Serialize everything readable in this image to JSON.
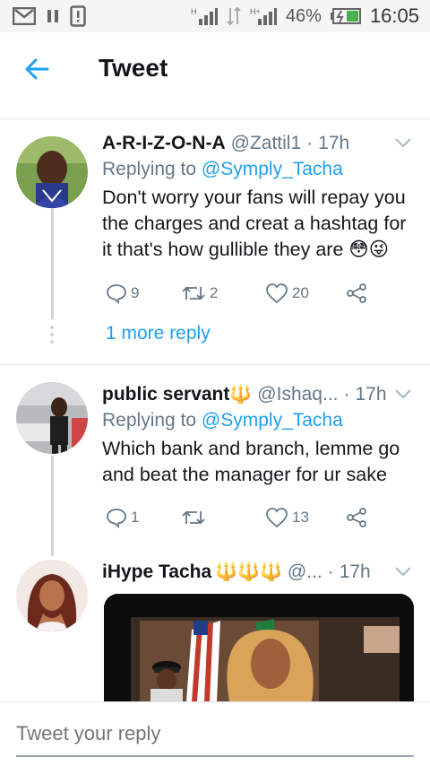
{
  "status_bar": {
    "battery_percent": "46%",
    "time": "16:05",
    "signal_label_1": "H",
    "signal_label_2": "H+"
  },
  "header": {
    "title": "Tweet",
    "back_icon": "arrow-left-icon"
  },
  "tweets": [
    {
      "name": "A-R-I-Z-O-N-A",
      "handle": "@Zattil1",
      "time": "17h",
      "replying_label": "Replying to",
      "replying_to": "@Symply_Tacha",
      "text": "Don't worry your fans will repay you the charges and creat a hashtag for it that's how gullible they are 😳😜",
      "replies": "9",
      "retweets": "2",
      "likes": "20",
      "more_replies": "1 more reply"
    },
    {
      "name": "public servant",
      "name_emoji": "🔱",
      "handle": "@Ishaq...",
      "time": "17h",
      "replying_label": "Replying to",
      "replying_to": "@Symply_Tacha",
      "text": "Which bank and branch, lemme go and beat the manager for ur sake",
      "replies": "1",
      "retweets": "",
      "likes": "13"
    },
    {
      "name": "iHype Tacha",
      "name_emoji": "🔱🔱🔱",
      "handle": "@...",
      "time": "17h"
    }
  ],
  "reply_bar": {
    "placeholder": "Tweet your reply"
  },
  "colors": {
    "accent": "#1da1f2",
    "muted": "#657786",
    "divider": "#e1e8ed"
  }
}
